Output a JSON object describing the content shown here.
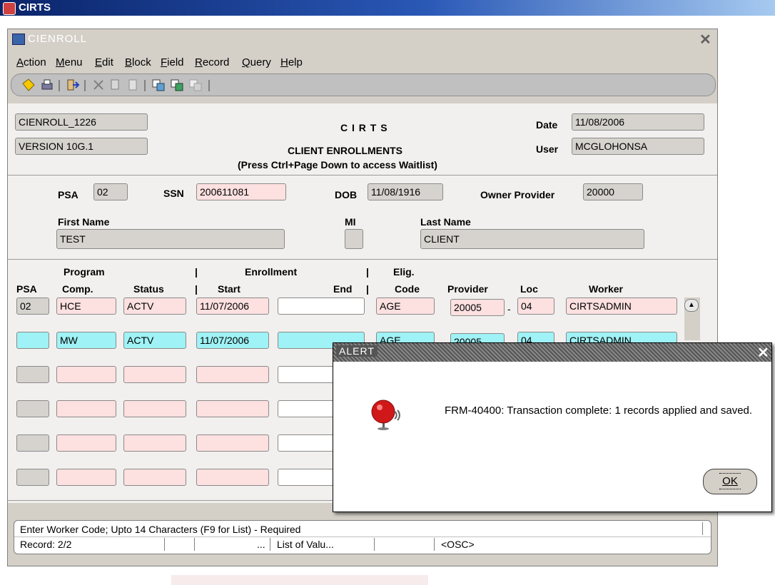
{
  "app_title": "CIRTS",
  "window": {
    "title": "CIENROLL",
    "close_glyph": "✕"
  },
  "menu": [
    "Action",
    "Menu",
    "Edit",
    "Block",
    "Field",
    "Record",
    "Query",
    "Help"
  ],
  "menu_mnemonics": [
    "A",
    "M",
    "E",
    "B",
    "F",
    "R",
    "Q",
    "H"
  ],
  "toolbar_icons": [
    "save-icon",
    "print-icon",
    "exit-icon",
    "cut-icon",
    "copy-icon",
    "paste-icon",
    "enter-query-icon",
    "execute-query-icon",
    "cancel-query-icon"
  ],
  "header": {
    "form_id": "CIENROLL_1226",
    "version": "VERSION 10G.1",
    "system": "C I R T S",
    "subtitle": "CLIENT ENROLLMENTS",
    "hint": "(Press Ctrl+Page Down to access Waitlist)",
    "date_label": "Date",
    "date_value": "11/08/2006",
    "user_label": "User",
    "user_value": "MCGLOHONSA"
  },
  "client": {
    "psa_label": "PSA",
    "psa_value": "02",
    "ssn_label": "SSN",
    "ssn_value": "200611081",
    "dob_label": "DOB",
    "dob_value": "11/08/1916",
    "owner_label": "Owner Provider",
    "owner_value": "20000",
    "first_name_label": "First Name",
    "first_name_value": "TEST",
    "mi_label": "MI",
    "mi_value": "",
    "last_name_label": "Last Name",
    "last_name_value": "CLIENT"
  },
  "grid": {
    "headers": {
      "program": "Program",
      "enrollment": "Enrollment",
      "elig": "Elig.",
      "psa": "PSA",
      "comp": "Comp.",
      "status": "Status",
      "start": "Start",
      "end": "End",
      "code": "Code",
      "provider": "Provider",
      "loc": "Loc",
      "worker": "Worker",
      "sep": "|"
    },
    "dash": "-",
    "rows": [
      {
        "psa": "02",
        "comp": "HCE",
        "status": "ACTV",
        "start": "11/07/2006",
        "end": "",
        "code": "AGE",
        "provider": "20005",
        "loc": "04",
        "worker": "CIRTSADMIN"
      },
      {
        "psa": "",
        "comp": "MW",
        "status": "ACTV",
        "start": "11/07/2006",
        "end": "",
        "code": "AGE",
        "provider": "20005",
        "loc": "04",
        "worker": "CIRTSADMIN"
      }
    ]
  },
  "status": {
    "message": "Enter Worker Code; Upto 14 Characters (F9 for List) - Required",
    "record": "Record: 2/2",
    "ellipsis": "...",
    "lov": "List of Valu...",
    "osc": "<OSC>"
  },
  "alert": {
    "title": "ALERT",
    "message": "FRM-40400: Transaction complete: 1 records applied and saved.",
    "ok_label": "OK"
  },
  "colors": {
    "title_bar": "#0a246a",
    "field_gray": "#d6d3ce",
    "field_pink": "#fde0e0",
    "field_cyan": "#9ff2f5",
    "bell_red": "#d01818"
  }
}
